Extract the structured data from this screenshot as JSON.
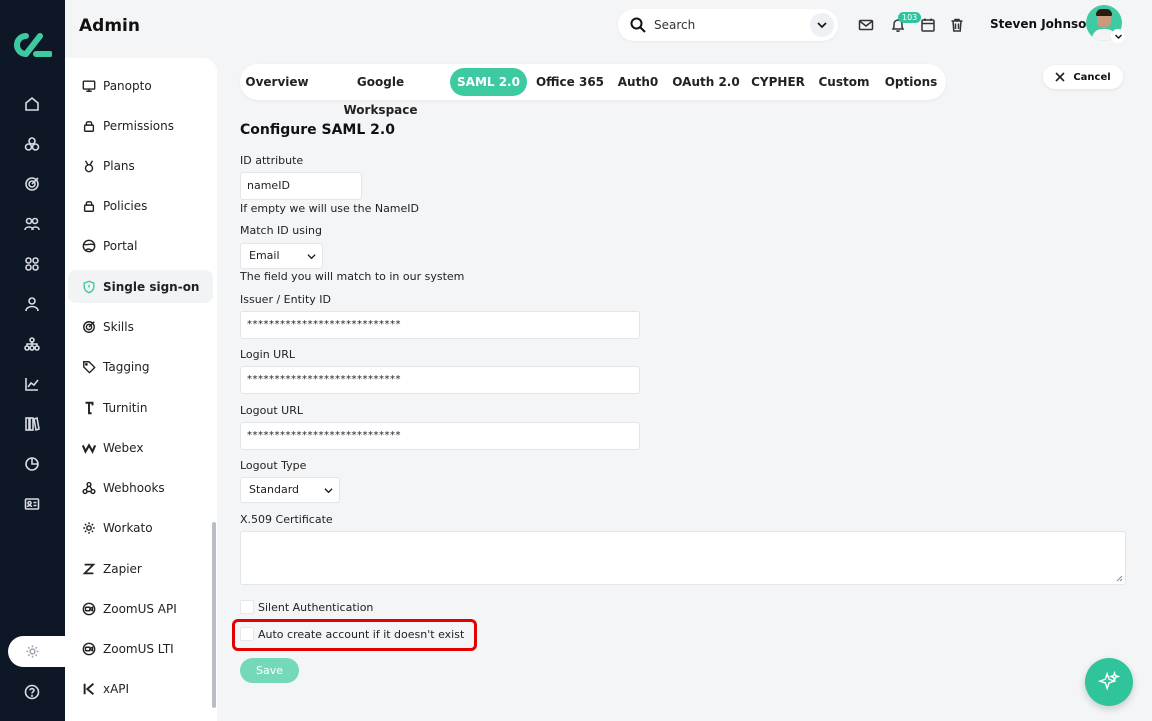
{
  "app": {
    "title": "Admin"
  },
  "header": {
    "search_label": "Search",
    "notification_count": "103",
    "user_name": "Steven Johnson"
  },
  "colors": {
    "accent": "#3ecaa0",
    "rail": "#0e1726",
    "highlight": "#e40000"
  },
  "rail_icons": [
    "home-icon",
    "dashboard-icon",
    "target-icon",
    "users-icon",
    "grid-icon",
    "person-icon",
    "org-chart-icon",
    "analytics-icon",
    "library-icon",
    "pie-chart-icon",
    "id-card-icon",
    "settings-icon",
    "help-icon"
  ],
  "sidenav": {
    "items": [
      {
        "label": "Panopto",
        "icon": "monitor-icon"
      },
      {
        "label": "Permissions",
        "icon": "lock-icon"
      },
      {
        "label": "Plans",
        "icon": "medal-icon"
      },
      {
        "label": "Policies",
        "icon": "lock-icon"
      },
      {
        "label": "Portal",
        "icon": "globe-icon"
      },
      {
        "label": "Single sign-on",
        "icon": "shield-icon"
      },
      {
        "label": "Skills",
        "icon": "target-icon"
      },
      {
        "label": "Tagging",
        "icon": "tag-icon"
      },
      {
        "label": "Turnitin",
        "icon": "turnitin-icon"
      },
      {
        "label": "Webex",
        "icon": "webex-icon"
      },
      {
        "label": "Webhooks",
        "icon": "webhook-icon"
      },
      {
        "label": "Workato",
        "icon": "gear-icon"
      },
      {
        "label": "Zapier",
        "icon": "zapier-icon"
      },
      {
        "label": "ZoomUS API",
        "icon": "zoom-icon"
      },
      {
        "label": "ZoomUS LTI",
        "icon": "zoom-icon"
      },
      {
        "label": "xAPI",
        "icon": "xapi-icon"
      }
    ],
    "active": "Single sign-on"
  },
  "tabs": {
    "items": [
      "Overview",
      "Google Workspace",
      "SAML 2.0",
      "Office 365",
      "Auth0",
      "OAuth 2.0",
      "CYPHER",
      "Custom",
      "Options"
    ],
    "active": "SAML 2.0"
  },
  "cancel_label": "Cancel",
  "form": {
    "title": "Configure SAML 2.0",
    "id_attribute": {
      "label": "ID attribute",
      "value": "nameID",
      "help": "If empty we will use the NameID"
    },
    "match_id": {
      "label": "Match ID using",
      "value": "Email",
      "help": "The field you will match to in our system"
    },
    "issuer": {
      "label": "Issuer / Entity ID",
      "value": "****************************"
    },
    "login_url": {
      "label": "Login URL",
      "value": "****************************"
    },
    "logout_url": {
      "label": "Logout URL",
      "value": "****************************"
    },
    "logout_type": {
      "label": "Logout Type",
      "value": "Standard"
    },
    "certificate": {
      "label": "X.509 Certificate",
      "value": ""
    },
    "silent_auth": {
      "label": "Silent Authentication",
      "checked": false
    },
    "auto_create": {
      "label": "Auto create account if it doesn't exist",
      "checked": false
    },
    "save_label": "Save"
  }
}
